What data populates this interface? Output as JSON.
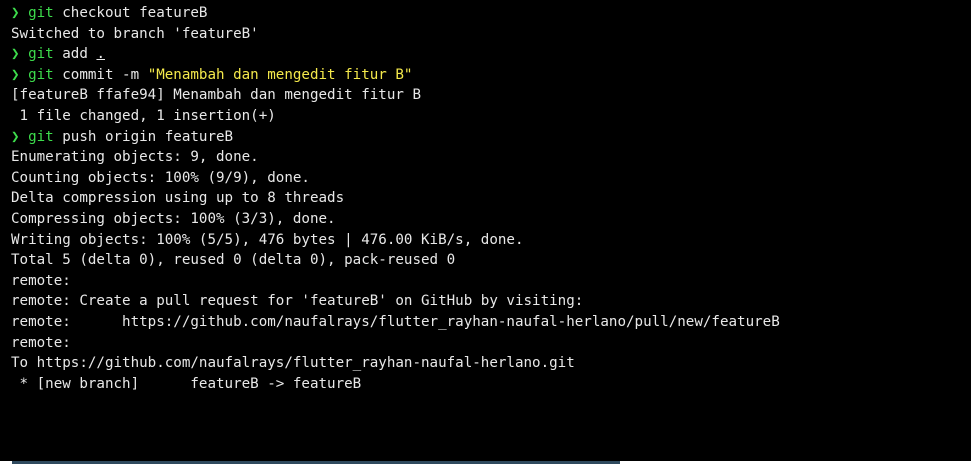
{
  "colors": {
    "background": "#000000",
    "text": "#e8e8e8",
    "prompt": "#3ddc4c",
    "string": "#f4e94b"
  },
  "prompt_symbol": "❯",
  "commands": [
    {
      "cmd": "git",
      "args": "checkout featureB"
    },
    {
      "cmd": "git",
      "args": "add",
      "underlined_arg": "."
    },
    {
      "cmd": "git",
      "args": "commit -m",
      "string": "\"Menambah dan mengedit fitur B\""
    },
    {
      "cmd": "git",
      "args": "push origin featureB"
    }
  ],
  "output": {
    "checkout": [
      "Switched to branch 'featureB'"
    ],
    "commit": [
      "[featureB ffafe94] Menambah dan mengedit fitur B",
      " 1 file changed, 1 insertion(+)"
    ],
    "push": [
      "Enumerating objects: 9, done.",
      "Counting objects: 100% (9/9), done.",
      "Delta compression using up to 8 threads",
      "Compressing objects: 100% (3/3), done.",
      "Writing objects: 100% (5/5), 476 bytes | 476.00 KiB/s, done.",
      "Total 5 (delta 0), reused 0 (delta 0), pack-reused 0",
      "remote:",
      "remote: Create a pull request for 'featureB' on GitHub by visiting:",
      "remote:      https://github.com/naufalrays/flutter_rayhan-naufal-herlano/pull/new/featureB",
      "remote:",
      "To https://github.com/naufalrays/flutter_rayhan-naufal-herlano.git",
      " * [new branch]      featureB -> featureB"
    ]
  }
}
